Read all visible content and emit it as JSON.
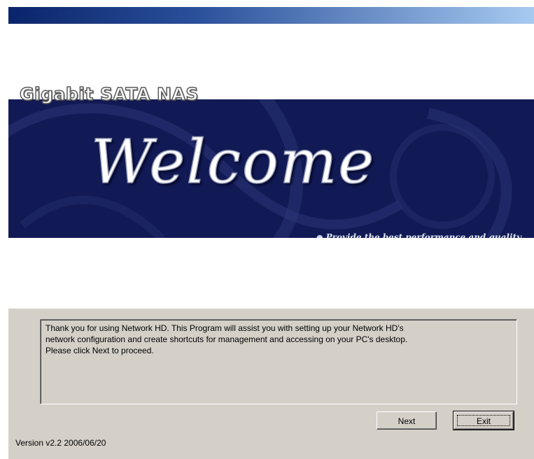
{
  "banner": {
    "product_name": "Gigabit SATA NAS",
    "welcome": "Welcome",
    "tagline": "Provide the best performance and quality"
  },
  "message": "Thank you for using Network HD. This Program will assist you with setting up your   Network HD's\nnetwork configuration and create shortcuts for management   and accessing on your PC's desktop.\nPlease click Next to proceed.",
  "buttons": {
    "next": "Next",
    "exit": "Exit"
  },
  "version": "Version v2.2 2006/06/20",
  "colors": {
    "banner_bg": "#121a55",
    "panel_bg": "#d4d0c8",
    "title_gradient_start": "#0a246a",
    "title_gradient_end": "#a6caf0"
  }
}
